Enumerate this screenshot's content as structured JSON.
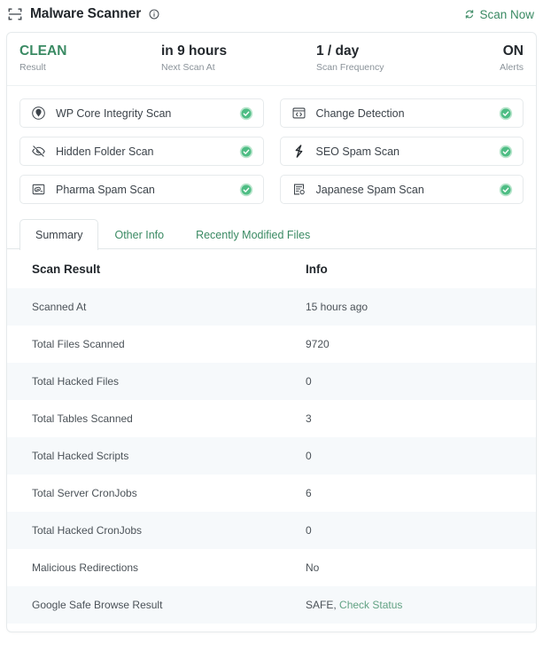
{
  "header": {
    "icon": "scan-frame-icon",
    "title": "Malware Scanner",
    "info_icon": "info-icon",
    "action": {
      "icon": "refresh-icon",
      "label": "Scan Now"
    }
  },
  "colors": {
    "accent_green": "#3a8a63",
    "link_green": "#62a284",
    "badge_green": "#52c287",
    "text_dark": "#23282d",
    "text_muted": "#8a9299",
    "row_stripe": "#f6f9fb",
    "border": "#e6eaec"
  },
  "stats": [
    {
      "value": "CLEAN",
      "label": "Result"
    },
    {
      "value": "in 9 hours",
      "label": "Next Scan At"
    },
    {
      "value": "1 / day",
      "label": "Scan Frequency"
    },
    {
      "value": "ON",
      "label": "Alerts"
    }
  ],
  "scan_items": [
    {
      "label": "WP Core Integrity Scan",
      "icon": "wordpress-icon",
      "status_icon": "check-circle-icon"
    },
    {
      "label": "Change Detection",
      "icon": "code-window-icon",
      "status_icon": "check-circle-icon"
    },
    {
      "label": "Hidden Folder Scan",
      "icon": "eye-off-icon",
      "status_icon": "check-circle-icon"
    },
    {
      "label": "SEO Spam Scan",
      "icon": "lightning-bolt-icon",
      "status_icon": "check-circle-icon"
    },
    {
      "label": "Pharma Spam Scan",
      "icon": "pill-box-icon",
      "status_icon": "check-circle-icon"
    },
    {
      "label": "Japanese Spam Scan",
      "icon": "document-list-icon",
      "status_icon": "check-circle-icon"
    }
  ],
  "tabs": [
    {
      "label": "Summary",
      "active": true
    },
    {
      "label": "Other Info",
      "active": false
    },
    {
      "label": "Recently Modified Files",
      "active": false
    }
  ],
  "table": {
    "headers": [
      "Scan Result",
      "Info"
    ],
    "rows": [
      {
        "key": "Scanned At",
        "value": "15 hours ago"
      },
      {
        "key": "Total Files Scanned",
        "value": "9720"
      },
      {
        "key": "Total Hacked Files",
        "value": "0"
      },
      {
        "key": "Total Tables Scanned",
        "value": "3"
      },
      {
        "key": "Total Hacked Scripts",
        "value": "0"
      },
      {
        "key": "Total Server CronJobs",
        "value": "6"
      },
      {
        "key": "Total Hacked CronJobs",
        "value": "0"
      },
      {
        "key": "Malicious Redirections",
        "value": "No"
      },
      {
        "key": "Google Safe Browse Result",
        "value": "SAFE,",
        "link": "Check Status"
      }
    ]
  }
}
